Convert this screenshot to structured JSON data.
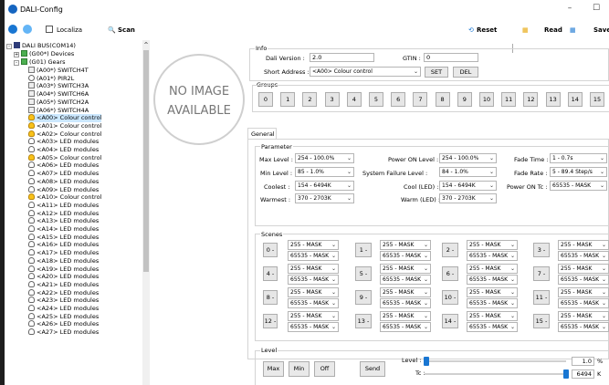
{
  "window": {
    "title": "DALI-Config",
    "minimize": "–",
    "maximize": "☐"
  },
  "toolbar": {
    "localiza": "Localiza",
    "scan": "Scan",
    "reset": "Reset",
    "read": "Read",
    "save": "Save"
  },
  "tree": {
    "root": "DALI BUS(COM14)",
    "devices": "(G00*) Devices",
    "gears": "(G01) Gears",
    "items": [
      "(A00*) SWITCH4T",
      "(A01*) PIR2L",
      "(A03*) SWITCH3A",
      "(A04*) SWITCH6A",
      "(A05*) SWITCH2A",
      "(A06*) SWITCH4A",
      "<A00> Colour control",
      "<A01> Colour control",
      "<A02> Colour control",
      "<A03> LED modules",
      "<A04> LED modules",
      "<A05> Colour control",
      "<A06> LED modules",
      "<A07> LED modules",
      "<A08> LED modules",
      "<A09> LED modules",
      "<A10> Colour control",
      "<A11> LED modules",
      "<A12> LED modules",
      "<A13> LED modules",
      "<A14> LED modules",
      "<A15> LED modules",
      "<A16> LED modules",
      "<A17> LED modules",
      "<A18> LED modules",
      "<A19> LED modules",
      "<A20> LED modules",
      "<A21> LED modules",
      "<A22> LED modules",
      "<A23> LED modules",
      "<A24> LED modules",
      "<A25> LED modules",
      "<A26> LED modules",
      "<A27> LED modules"
    ]
  },
  "noimage": {
    "line1": "NO IMAGE",
    "line2": "AVAILABLE"
  },
  "info": {
    "legend": "Info",
    "dali_version_label": "Dali Version :",
    "dali_version": "2.0",
    "gtin_label": "GTIN :",
    "gtin": "0",
    "short_address_label": "Short Address :",
    "short_address": "<A00> Colour control",
    "set": "SET",
    "del": "DEL"
  },
  "groups": {
    "legend": "Groups",
    "buttons": [
      "0",
      "1",
      "2",
      "3",
      "4",
      "5",
      "6",
      "7",
      "8",
      "9",
      "10",
      "11",
      "12",
      "13",
      "14",
      "15"
    ]
  },
  "tab": {
    "general": "General"
  },
  "parameter": {
    "legend": "Parameter",
    "max_level_label": "Max Level :",
    "max_level": "254 - 100.0%",
    "min_level_label": "Min Level :",
    "min_level": "85 - 1.0%",
    "coolest_label": "Coolest :",
    "coolest": "154 - 6494K",
    "warmest_label": "Warmest :",
    "warmest": "370 - 2703K",
    "power_on_level_label": "Power ON Level :",
    "power_on_level": "254 - 100.0%",
    "system_failure_label": "System Failure Level :",
    "system_failure": "84 - 1.0%",
    "cool_led_label": "Cool (LED) :",
    "cool_led": "154 - 6494K",
    "warm_led_label": "Warm (LED) :",
    "warm_led": "370 - 2703K",
    "fade_time_label": "Fade Time :",
    "fade_time": "1 - 0.7s",
    "fade_rate_label": "Fade Rate :",
    "fade_rate": "5 - 89.4 Step/s",
    "power_on_tc_label": "Power ON Tc :",
    "power_on_tc": "65535 - MASK"
  },
  "scenes": {
    "legend": "Scenes",
    "items": [
      {
        "label": "0 -",
        "a": "255 - MASK",
        "b": "65535 - MASK"
      },
      {
        "label": "1 -",
        "a": "255 - MASK",
        "b": "65535 - MASK"
      },
      {
        "label": "2 -",
        "a": "255 - MASK",
        "b": "65535 - MASK"
      },
      {
        "label": "3 -",
        "a": "255 - MASK",
        "b": "65535 - MASK"
      },
      {
        "label": "4 -",
        "a": "255 - MASK",
        "b": "65535 - MASK"
      },
      {
        "label": "5 -",
        "a": "255 - MASK",
        "b": "65535 - MASK"
      },
      {
        "label": "6 -",
        "a": "255 - MASK",
        "b": "65535 - MASK"
      },
      {
        "label": "7 -",
        "a": "255 - MASK",
        "b": "65535 - MASK"
      },
      {
        "label": "8 -",
        "a": "255 - MASK",
        "b": "65535 - MASK"
      },
      {
        "label": "9 -",
        "a": "255 - MASK",
        "b": "65535 - MASK"
      },
      {
        "label": "10 -",
        "a": "255 - MASK",
        "b": "65535 - MASK"
      },
      {
        "label": "11 -",
        "a": "255 - MASK",
        "b": "65535 - MASK"
      },
      {
        "label": "12 -",
        "a": "255 - MASK",
        "b": "65535 - MASK"
      },
      {
        "label": "13 -",
        "a": "255 - MASK",
        "b": "65535 - MASK"
      },
      {
        "label": "14 -",
        "a": "255 - MASK",
        "b": "65535 - MASK"
      },
      {
        "label": "15 -",
        "a": "255 - MASK",
        "b": "65535 - MASK"
      }
    ]
  },
  "level": {
    "legend": "Level",
    "max": "Max",
    "min": "Min",
    "off": "Off",
    "send": "Send",
    "level_label": "Level :",
    "level_value": "1.0",
    "level_unit": "%",
    "level_fraction": 0.01,
    "tc_label": "Tc :",
    "tc_value": "6494",
    "tc_unit": "K",
    "tc_fraction": 1.0
  },
  "colors": {
    "accent": "#1976d2",
    "selected": "#cce8ff"
  }
}
